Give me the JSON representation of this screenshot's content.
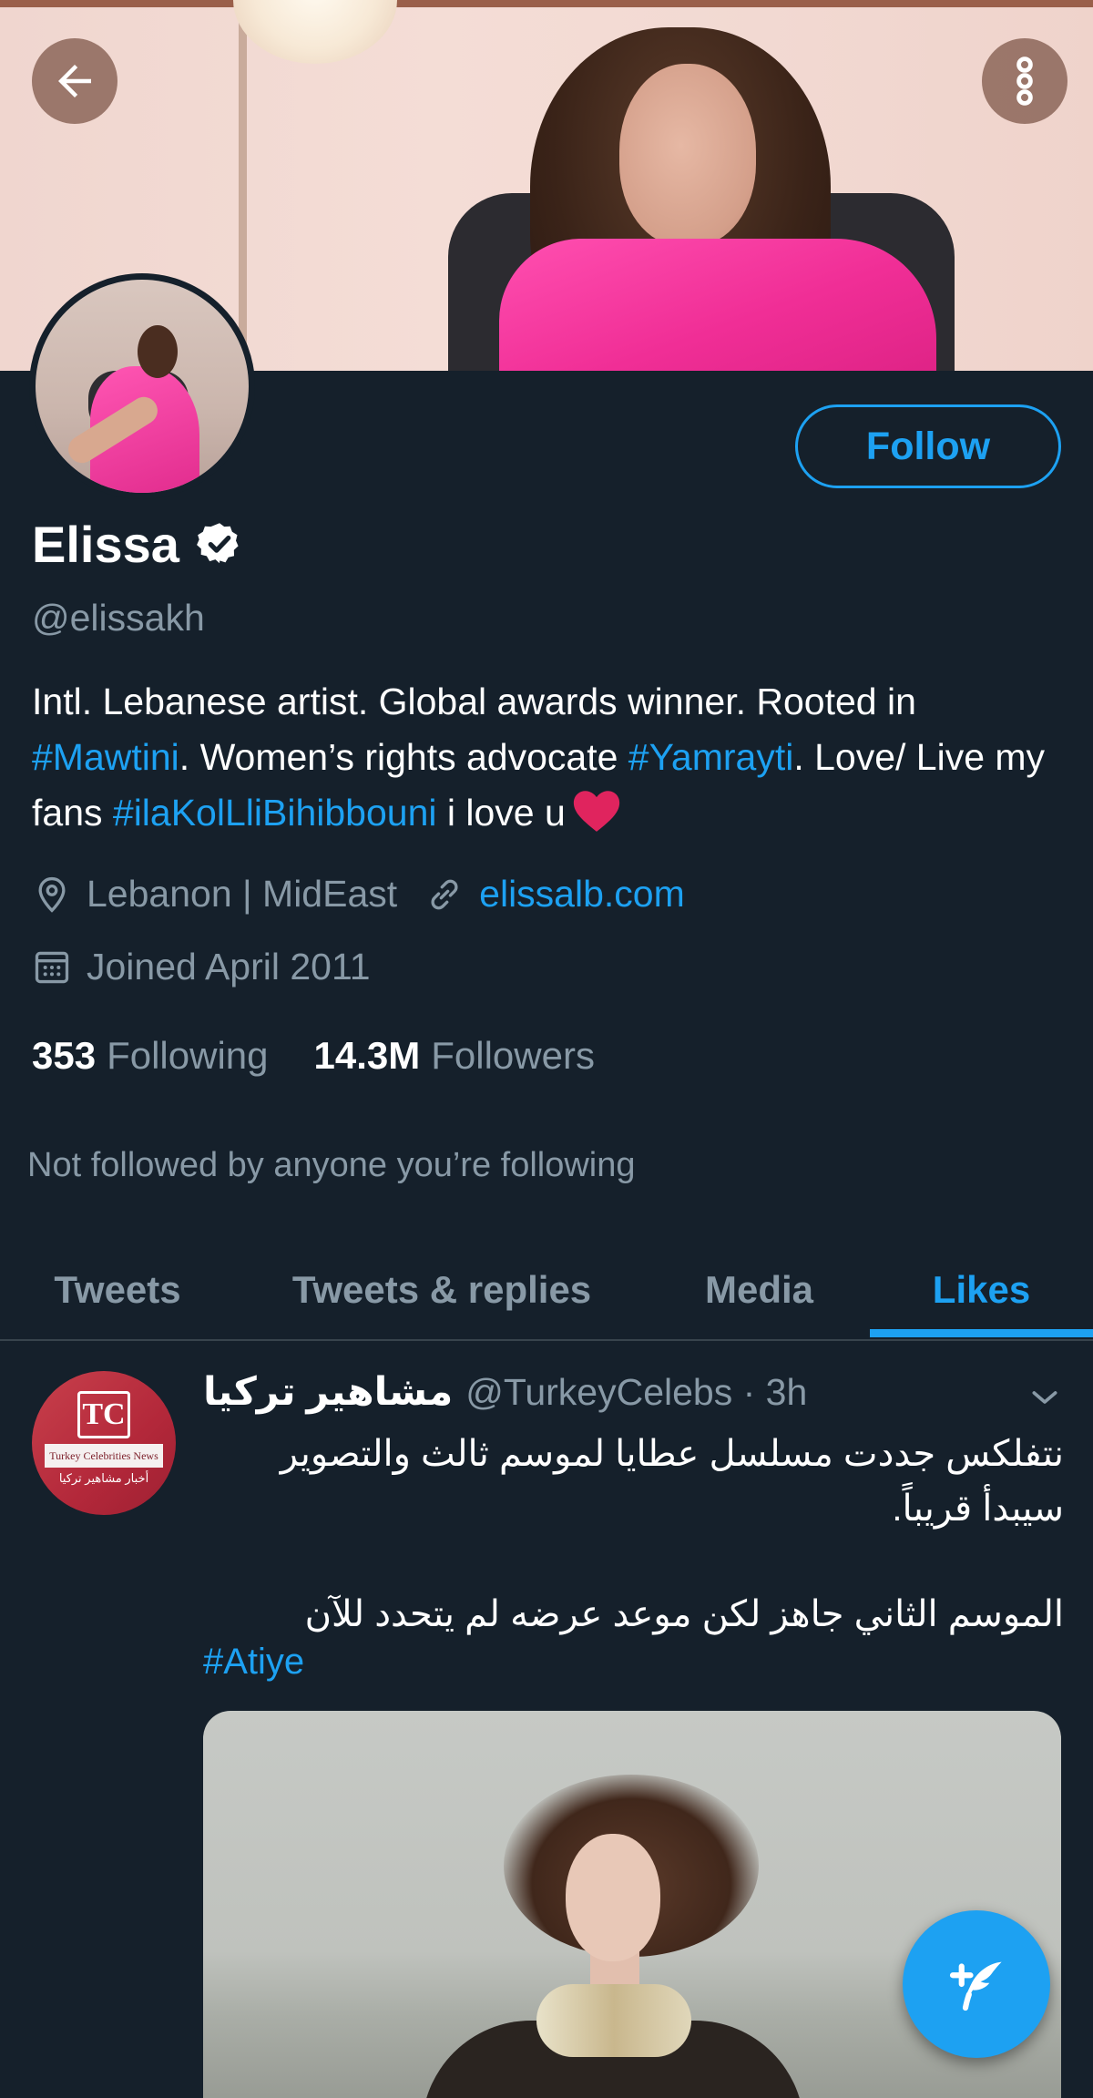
{
  "banner": {
    "back_label": "Back",
    "more_label": "More options"
  },
  "profile": {
    "display_name": "Elissa",
    "handle": "@elissakh",
    "follow_label": "Follow",
    "bio": {
      "part1": "Intl. Lebanese artist. Global awards winner. Rooted in ",
      "tag1": "#Mawtini",
      "part2": ". Women’s rights advocate ",
      "tag2": "#Yamrayti",
      "part3": ". Love/ Live my fans ",
      "tag3": "#ilaKolLliBihibbouni",
      "part4": " i love u"
    },
    "location": "Lebanon | MidEast",
    "website": "elissalb.com",
    "joined": "Joined April 2011",
    "following_count": "353",
    "following_label": "Following",
    "followers_count": "14.3M",
    "followers_label": "Followers",
    "not_followed": "Not followed by anyone you’re following"
  },
  "tabs": [
    {
      "label": "Tweets",
      "active": false
    },
    {
      "label": "Tweets & replies",
      "active": false
    },
    {
      "label": "Media",
      "active": false
    },
    {
      "label": "Likes",
      "active": true
    }
  ],
  "tweet": {
    "author_name": "مشاهير تركيا",
    "author_handle": "@TurkeyCelebs · 3h",
    "avatar": {
      "logo_text": "TC",
      "band_text": "Turkey Celebrities News",
      "arabic_text": "أخبار مشاهير تركيا"
    },
    "text_para1": "نتفلكس جددت مسلسل عطايا لموسم ثالث والتصوير سيبدأ قريباً.",
    "text_para2": "الموسم الثاني جاهز لكن موعد عرضه لم يتحدد للآن",
    "hashtag": "#Atiye"
  },
  "colors": {
    "background": "#15202b",
    "accent": "#1da1f2",
    "secondary_text": "#8899a6",
    "divider": "#38444d",
    "heart": "#e0245e"
  },
  "icons": [
    "back-arrow-icon",
    "more-vertical-icon",
    "verified-badge-icon",
    "location-pin-icon",
    "link-icon",
    "calendar-icon",
    "chevron-down-icon",
    "compose-tweet-icon",
    "heart-emoji-icon"
  ]
}
